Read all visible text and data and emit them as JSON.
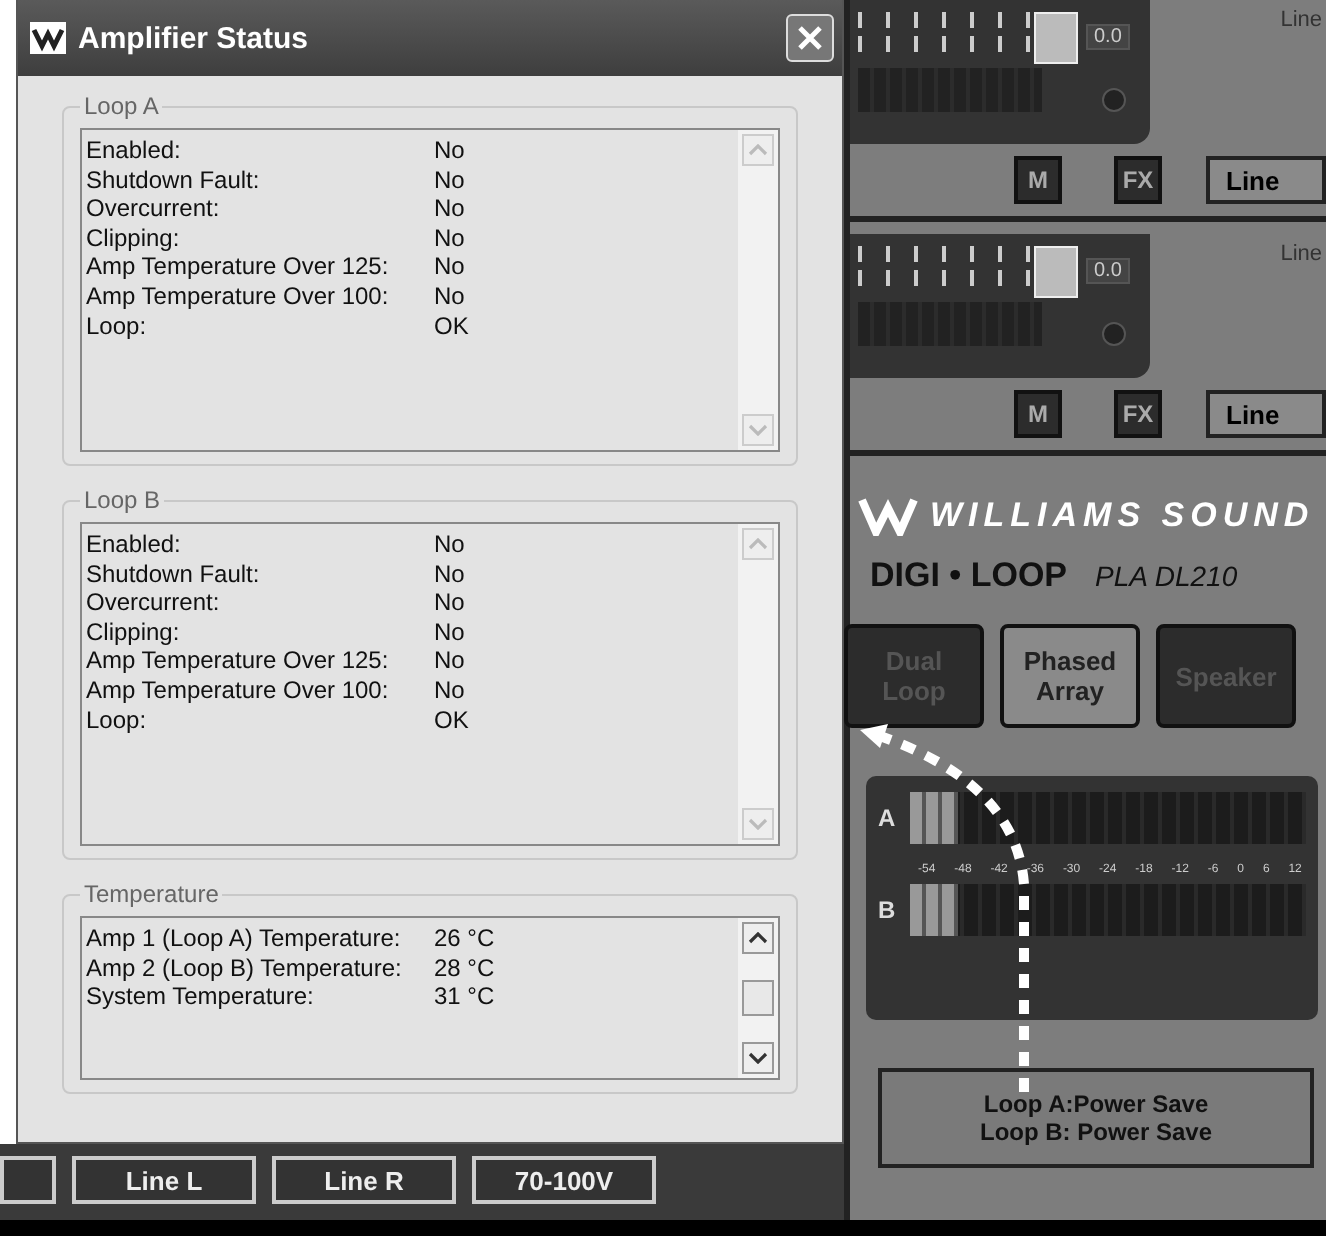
{
  "dialog": {
    "title": "Amplifier Status",
    "groups": [
      {
        "title": "Loop A",
        "scroll_enabled": false,
        "rows": [
          {
            "label": "Enabled:",
            "value": "No"
          },
          {
            "label": "Shutdown Fault:",
            "value": "No"
          },
          {
            "label": "Overcurrent:",
            "value": "No"
          },
          {
            "label": "Clipping:",
            "value": "No"
          },
          {
            "label": "Amp Temperature Over 125:",
            "value": "No"
          },
          {
            "label": "Amp Temperature Over 100:",
            "value": "No"
          },
          {
            "label": "Loop:",
            "value": "OK"
          }
        ]
      },
      {
        "title": "Loop B",
        "scroll_enabled": false,
        "rows": [
          {
            "label": "Enabled:",
            "value": "No"
          },
          {
            "label": "Shutdown Fault:",
            "value": "No"
          },
          {
            "label": "Overcurrent:",
            "value": "No"
          },
          {
            "label": "Clipping:",
            "value": "No"
          },
          {
            "label": "Amp Temperature Over 125:",
            "value": "No"
          },
          {
            "label": "Amp Temperature Over 100:",
            "value": "No"
          },
          {
            "label": "Loop:",
            "value": "OK"
          }
        ]
      },
      {
        "title": "Temperature",
        "scroll_enabled": true,
        "rows": [
          {
            "label": "Amp 1 (Loop A) Temperature:",
            "value": "26 °C"
          },
          {
            "label": "Amp 2 (Loop B) Temperature:",
            "value": "28 °C"
          },
          {
            "label": "System Temperature:",
            "value": "31 °C"
          }
        ]
      }
    ]
  },
  "background_app": {
    "channels": [
      {
        "label": "Line",
        "reading": "0.0",
        "buttons": [
          "M",
          "FX",
          "Line"
        ]
      },
      {
        "label": "Line",
        "reading": "0.0",
        "buttons": [
          "M",
          "FX",
          "Line"
        ]
      }
    ],
    "brand": "WILLIAMS SOUND",
    "product": "DIGI • LOOP",
    "model": "PLA DL210",
    "modes": [
      {
        "label": "Dual Loop",
        "selected": false
      },
      {
        "label": "Phased Array",
        "selected": true
      },
      {
        "label": "Speaker",
        "selected": false
      }
    ],
    "meter": {
      "channels": [
        {
          "label": "A",
          "level": 0.12
        },
        {
          "label": "B",
          "level": 0.12
        }
      ],
      "scale": [
        "-54",
        "-48",
        "-42",
        "-36",
        "-30",
        "-24",
        "-18",
        "-12",
        "-6",
        "0",
        "6",
        "12"
      ]
    },
    "status": [
      "Loop A:Power Save",
      "Loop B: Power Save"
    ],
    "bottom_buttons": [
      "Line L",
      "Line R",
      "70-100V"
    ]
  }
}
